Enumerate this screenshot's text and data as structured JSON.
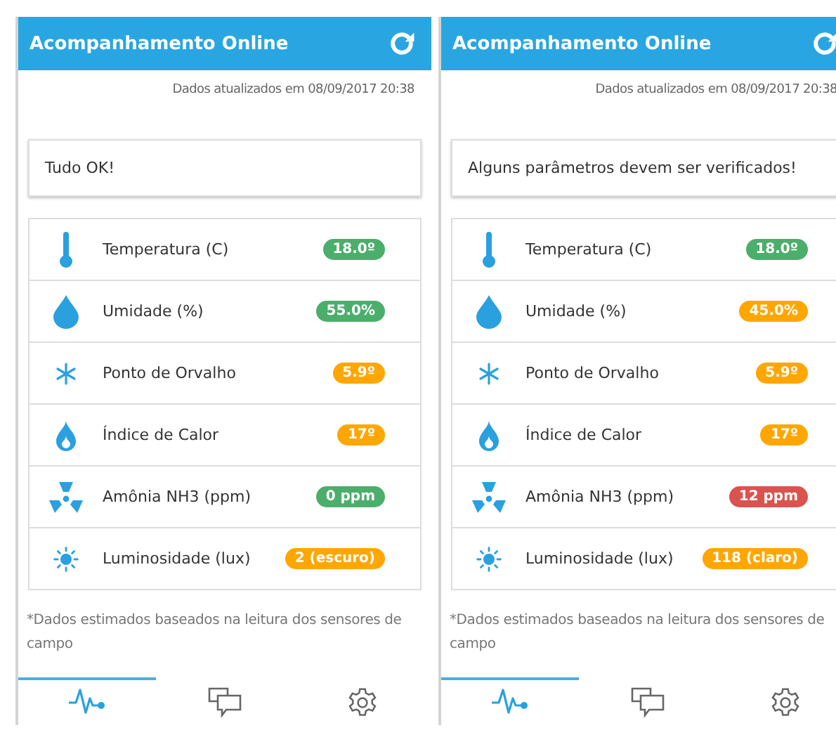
{
  "screens": [
    {
      "header": {
        "title": "Acompanhamento Online"
      },
      "updated": "Dados atualizados em 08/09/2017 20:38",
      "status": "Tudo OK!",
      "metrics": [
        {
          "kind": "thermometer",
          "label": "Temperatura (C)",
          "value": "18.0º",
          "color": "#4cae6b"
        },
        {
          "kind": "drop",
          "label": "Umidade (%)",
          "value": "55.0%",
          "color": "#4cae6b"
        },
        {
          "kind": "snowflake",
          "label": "Ponto de Orvalho",
          "value": "5.9º",
          "color": "#ffa600"
        },
        {
          "kind": "flame",
          "label": "Índice de Calor",
          "value": "17º",
          "color": "#ffa600"
        },
        {
          "kind": "radiation",
          "label": "Amônia NH3 (ppm)",
          "value": "0 ppm",
          "color": "#4cae6b"
        },
        {
          "kind": "sun",
          "label": "Luminosidade (lux)",
          "value": "2 (escuro)",
          "color": "#ffa600"
        }
      ],
      "footnote": "*Dados estimados baseados na leitura dos sensores de campo",
      "tabs": [
        {
          "kind": "pulse",
          "selected": true
        },
        {
          "kind": "chat",
          "selected": false
        },
        {
          "kind": "gear",
          "selected": false
        }
      ]
    },
    {
      "header": {
        "title": "Acompanhamento Online"
      },
      "updated": "Dados atualizados em 08/09/2017 20:38",
      "status": "Alguns parâmetros devem ser verificados!",
      "metrics": [
        {
          "kind": "thermometer",
          "label": "Temperatura (C)",
          "value": "18.0º",
          "color": "#4cae6b"
        },
        {
          "kind": "drop",
          "label": "Umidade (%)",
          "value": "45.0%",
          "color": "#ffa600"
        },
        {
          "kind": "snowflake",
          "label": "Ponto de Orvalho",
          "value": "5.9º",
          "color": "#ffa600"
        },
        {
          "kind": "flame",
          "label": "Índice de Calor",
          "value": "17º",
          "color": "#ffa600"
        },
        {
          "kind": "radiation",
          "label": "Amônia NH3 (ppm)",
          "value": "12 ppm",
          "color": "#d9534f"
        },
        {
          "kind": "sun",
          "label": "Luminosidade (lux)",
          "value": "118 (claro)",
          "color": "#ffa600"
        }
      ],
      "footnote": "*Dados estimados baseados na leitura dos sensores de campo",
      "tabs": [
        {
          "kind": "pulse",
          "selected": true
        },
        {
          "kind": "chat",
          "selected": false
        },
        {
          "kind": "gear",
          "selected": false
        }
      ]
    }
  ]
}
